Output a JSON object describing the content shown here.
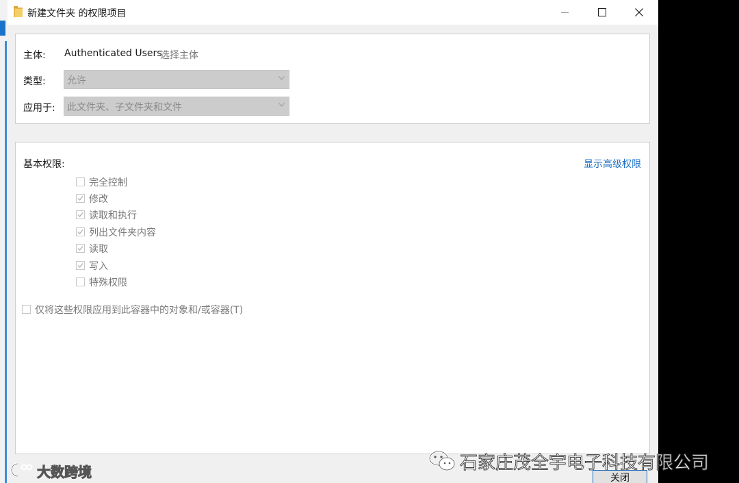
{
  "window": {
    "title": "新建文件夹 的权限项目"
  },
  "principal": {
    "label": "主体:",
    "value": "Authenticated Users",
    "select_link": "选择主体"
  },
  "type": {
    "label": "类型:",
    "value": "允许"
  },
  "applies_to": {
    "label": "应用于:",
    "value": "此文件夹、子文件夹和文件"
  },
  "basic_permissions": {
    "title": "基本权限:",
    "advanced_link": "显示高级权限",
    "items": [
      {
        "label": "完全控制",
        "checked": false
      },
      {
        "label": "修改",
        "checked": true
      },
      {
        "label": "读取和执行",
        "checked": true
      },
      {
        "label": "列出文件夹内容",
        "checked": true
      },
      {
        "label": "读取",
        "checked": true
      },
      {
        "label": "写入",
        "checked": true
      },
      {
        "label": "特殊权限",
        "checked": false
      }
    ]
  },
  "only_apply": {
    "label": "仅将这些权限应用到此容器中的对象和/或容器(T)",
    "checked": false
  },
  "footer": {
    "close_label": "关闭"
  },
  "watermarks": {
    "left": "大数跨境",
    "right": "石家庄茂全宇电子科技有限公司"
  },
  "colors": {
    "link_blue": "#1a6fc4",
    "disabled_text": "#7a7a7a",
    "disabled_combo": "#cccccc"
  }
}
